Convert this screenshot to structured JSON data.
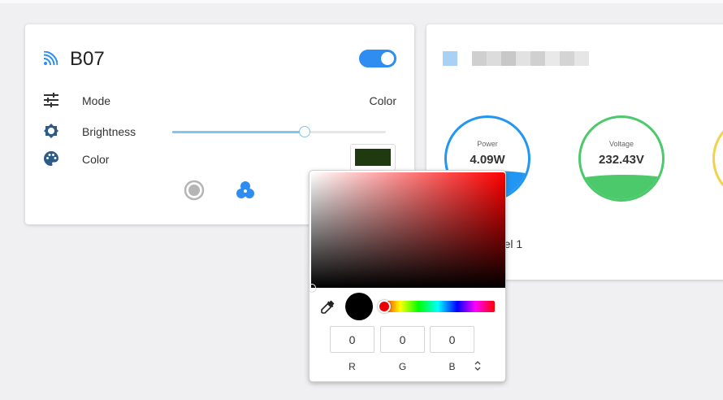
{
  "device": {
    "name": "B07",
    "power_on": true,
    "rows": {
      "mode": {
        "label": "Mode",
        "value": "Color"
      },
      "brightness": {
        "label": "Brightness",
        "level_percent": 62
      },
      "color": {
        "label": "Color",
        "swatch_color": "#1f3a0e"
      }
    },
    "accent_color": "#2f8cf0"
  },
  "energy": {
    "power": {
      "label": "Power",
      "value": "4.09W",
      "color": "#2196f3",
      "fill_percent": 35
    },
    "voltage": {
      "label": "Voltage",
      "value": "232.43V",
      "color": "#4cc96b",
      "fill_percent": 30
    },
    "channel_label": "nnel 1"
  },
  "color_picker": {
    "inputs": [
      {
        "label": "R",
        "value": "0"
      },
      {
        "label": "G",
        "value": "0"
      },
      {
        "label": "B",
        "value": "0"
      }
    ],
    "preview_color": "#000000"
  }
}
